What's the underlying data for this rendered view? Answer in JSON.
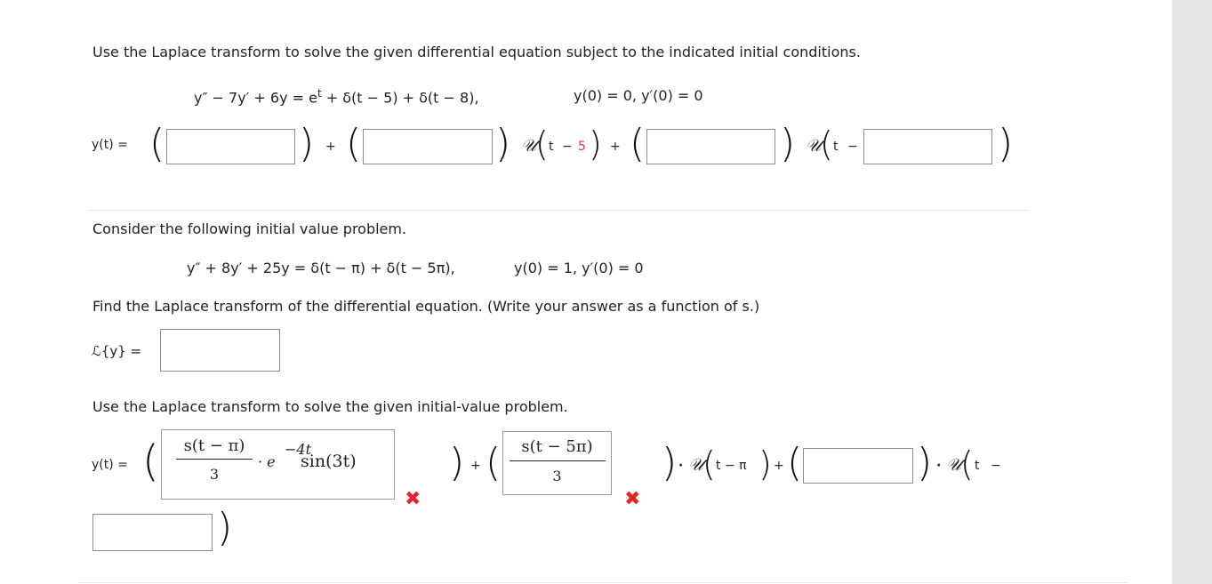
{
  "problem1": {
    "instruction": "Use the Laplace transform to solve the given differential equation subject to the indicated initial conditions.",
    "equation": "y″ − 7y′ + 6y = e",
    "equation_exp": "t",
    "equation_rest": " + δ(t − 5) + δ(t − 8),",
    "initial": "y(0) = 0, y′(0) = 0",
    "lhs": "y(t) =",
    "plus1": "+",
    "plus2": "+",
    "u1": "𝒰",
    "shift1_t": "t",
    "shift1_minus": "−",
    "shift1_val": "5",
    "u2": "𝒰",
    "shift2_t": "t",
    "shift2_minus": "−"
  },
  "problem2": {
    "intro": "Consider the following initial value problem.",
    "equation": "y″ + 8y′ + 25y = δ(t − π) + δ(t − 5π),",
    "initial": "y(0) = 1,  y′(0) = 0",
    "find_laplace": "Find the Laplace transform of the differential equation. (Write your answer as a function of s.)",
    "laplace_lhs": "ℒ{y} =",
    "solve": "Use the Laplace transform to solve the given initial-value problem.",
    "lhs": "y(t) =",
    "ans1_num": "s(t − π)",
    "ans1_den": "3",
    "ans1_rest": "· e",
    "ans1_exp": "−4t",
    "ans1_tail": "sin(3t)",
    "ans2_num": "s(t − 5π)",
    "ans2_den": "3",
    "plus1": "+",
    "plus2": "+",
    "dot1": "·",
    "dot2": "·",
    "u1": "𝒰",
    "shift1": "t − π",
    "u2": "𝒰",
    "shift2_t": "t",
    "shift2_minus": "−",
    "wrong_mark": "✖"
  }
}
